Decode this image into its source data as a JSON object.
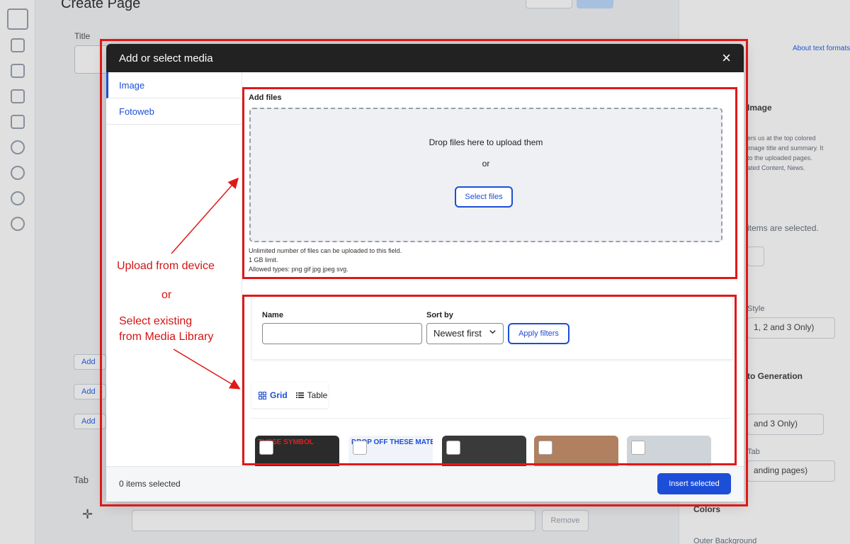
{
  "background": {
    "page_title": "Create Page",
    "title_label": "Title",
    "right_link": "About text formats",
    "right_heading": "Image",
    "right_desc": [
      "ers us at the top colored",
      "image title and summary. It",
      "to the uploaded pages.",
      "ated Content, News."
    ],
    "right_status": "items are selected.",
    "right_style_label": "Style",
    "right_style_value": "1, 2 and 3 Only)",
    "right_heading2": "to Generation",
    "right_select2": "and 3 Only)",
    "right_label3": "Tab",
    "right_select3": "anding pages)",
    "right_colors": "Colors",
    "right_outer_bg": "Outer Background",
    "left_btns": [
      "Add",
      "Add",
      "Add"
    ],
    "tab_label": "Tab",
    "remove_button": "Remove"
  },
  "modal": {
    "title": "Add or select media",
    "close_glyph": "×",
    "tabs": [
      {
        "label": "Image",
        "active": true
      },
      {
        "label": "Fotoweb",
        "active": false
      }
    ],
    "upload": {
      "label": "Add files",
      "drop_text": "Drop files here to upload them",
      "or_text": "or",
      "select_button": "Select files",
      "help": [
        "Unlimited number of files can be uploaded to this field.",
        "1 GB limit.",
        "Allowed types: png gif jpg jpeg svg."
      ]
    },
    "filters": {
      "name_label": "Name",
      "name_value": "",
      "sort_label": "Sort by",
      "sort_value": "Newest first",
      "apply_button": "Apply filters"
    },
    "view": {
      "grid_label": "Grid",
      "table_label": "Table"
    },
    "media_items": [
      {
        "caption": "THESE SYMBOL",
        "bg": "#2b2b2b",
        "caption_color": "#e02020"
      },
      {
        "caption": "DROP OFF THESE MATERIA",
        "bg": "#f0f4fa",
        "caption_color": "#1d4ed8"
      },
      {
        "caption": "",
        "bg": "#3a3a3a",
        "caption_color": "#ffffff"
      },
      {
        "caption": "",
        "bg": "#b08060",
        "caption_color": "#ffffff"
      },
      {
        "caption": "",
        "bg": "#cfd4d8",
        "caption_color": "#ffffff"
      }
    ],
    "footer": {
      "selected_text": "0 items selected",
      "insert_button": "Insert selected"
    }
  },
  "annotations": {
    "upload_text": "Upload from device",
    "or_text": "or",
    "library_line1": "Select existing",
    "library_line2": "from Media Library",
    "color": "#e01818"
  }
}
